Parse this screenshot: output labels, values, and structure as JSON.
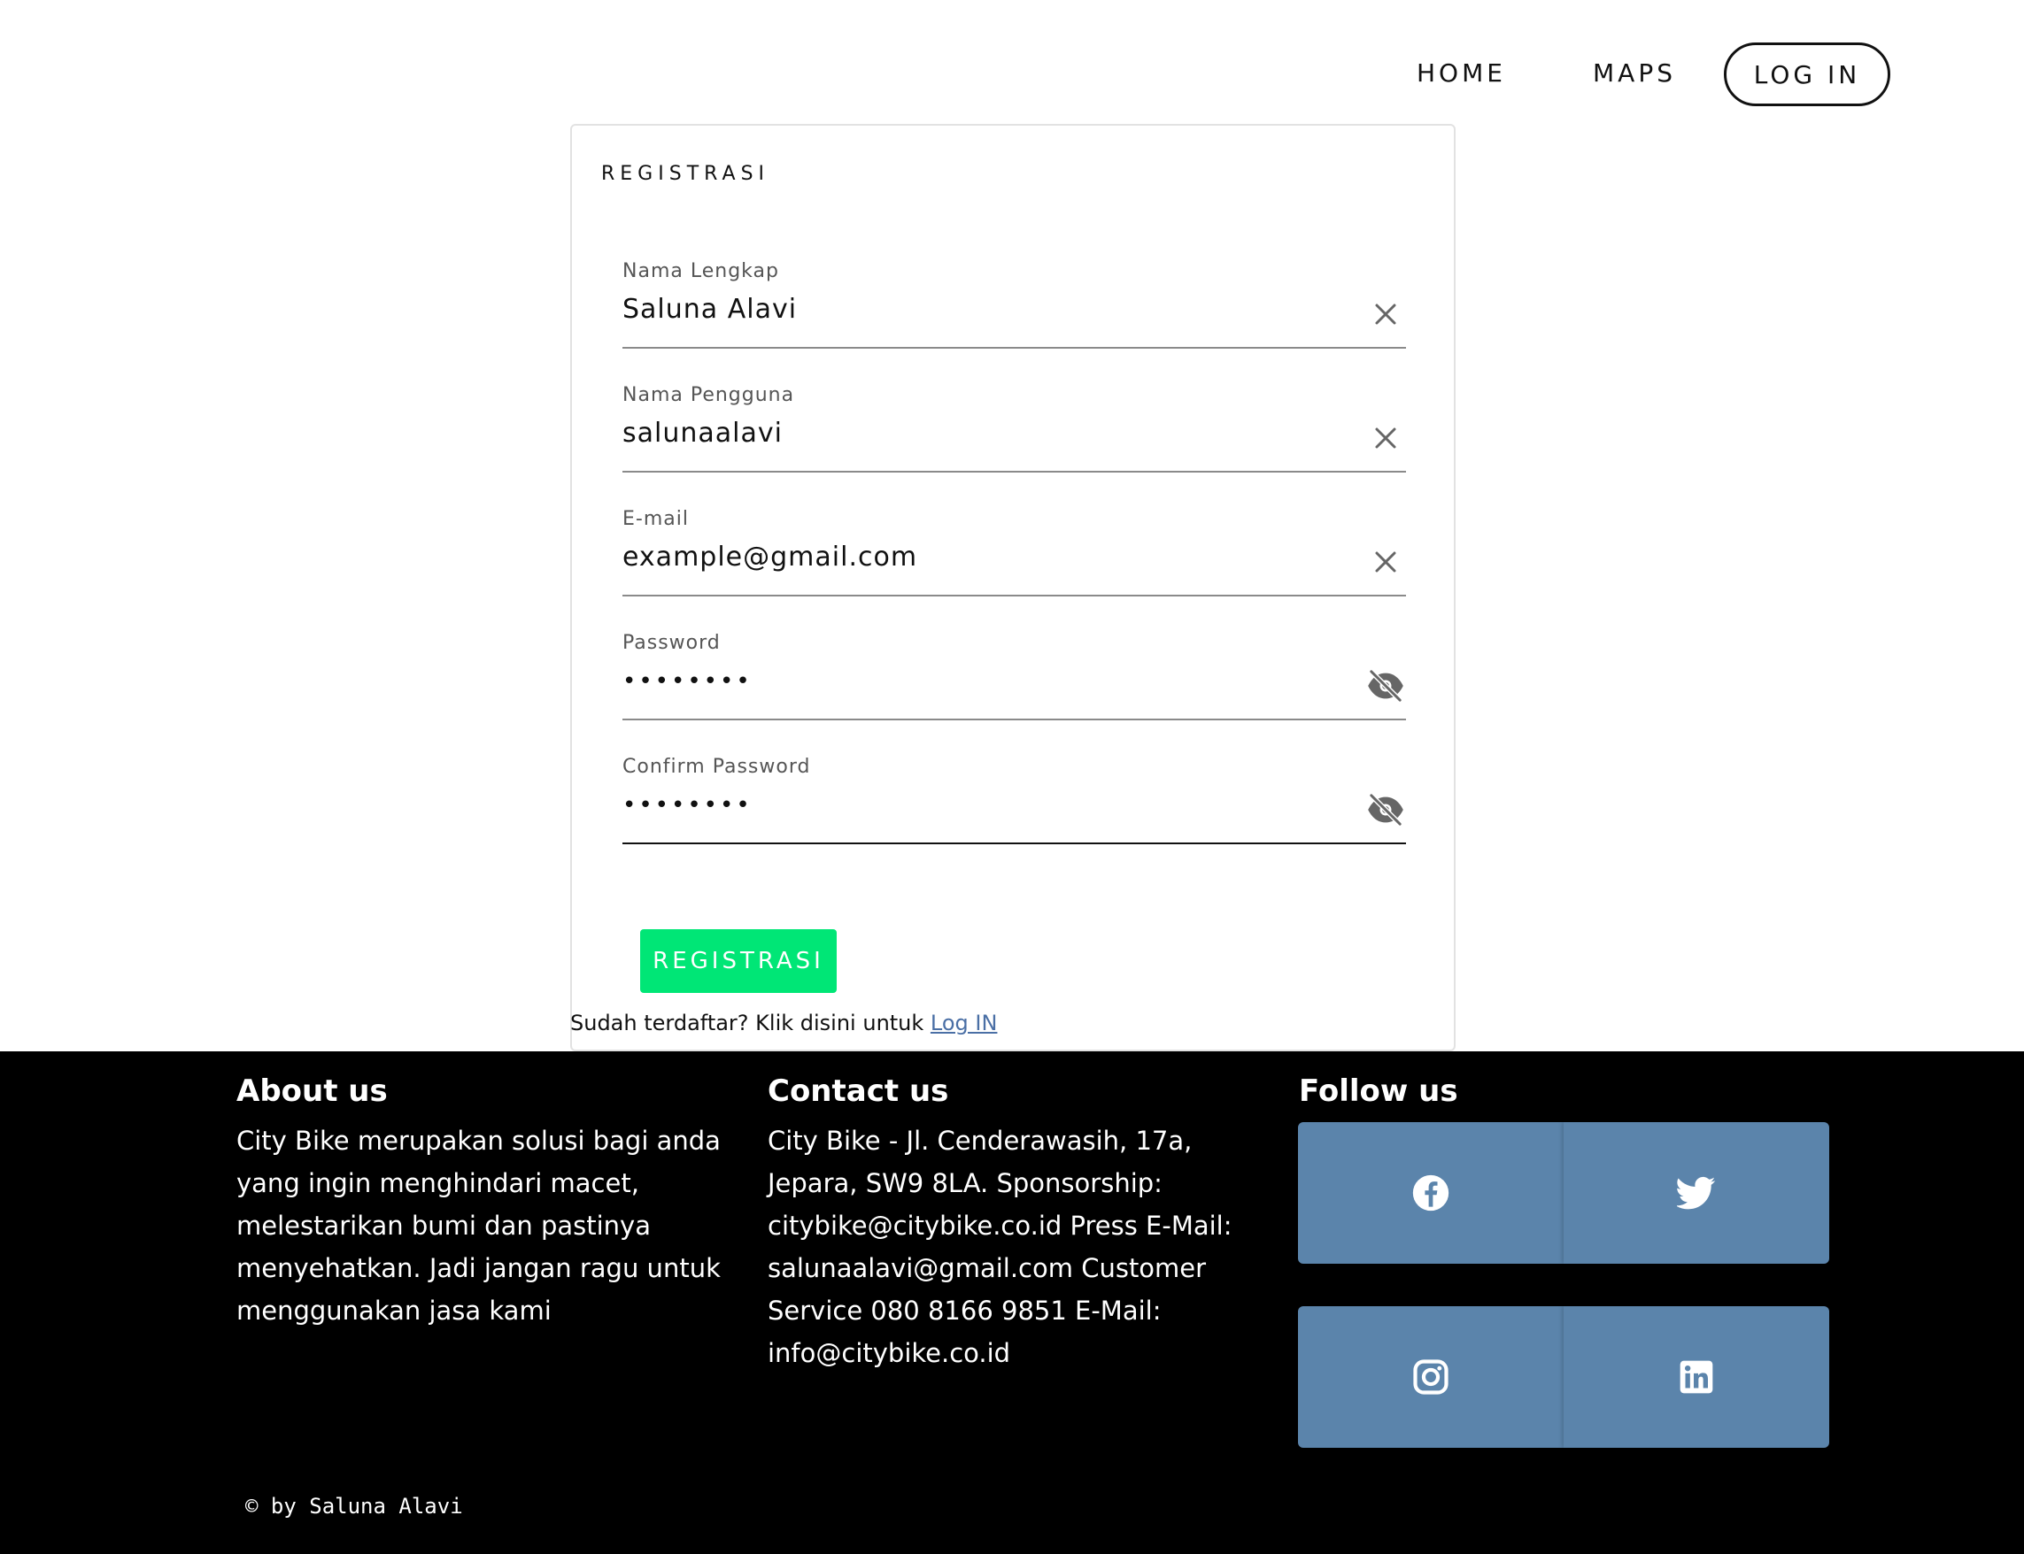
{
  "nav": {
    "home": "HOME",
    "maps": "MAPS",
    "login": "LOG IN"
  },
  "form": {
    "title": "REGISTRASI",
    "fields": [
      {
        "label": "Nama Lengkap",
        "value": "Saluna Alavi",
        "icon": "clear-icon"
      },
      {
        "label": "Nama Pengguna",
        "value": "salunaalavi",
        "icon": "clear-icon"
      },
      {
        "label": "E-mail",
        "value": "example@gmail.com",
        "icon": "clear-icon"
      },
      {
        "label": "Password",
        "value": "••••••••",
        "icon": "eye-off-icon"
      },
      {
        "label": "Confirm Password",
        "value": "••••••••",
        "icon": "eye-off-icon"
      }
    ],
    "submit": "REGISTRASI",
    "already_text": "Sudah terdaftar? Klik disini untuk ",
    "login_link": "Log IN"
  },
  "footer": {
    "about": {
      "title": "About us",
      "text": "City Bike merupakan solusi bagi anda yang ingin menghindari macet, melestarikan bumi dan pastinya menyehatkan. Jadi jangan ragu untuk menggunakan jasa kami"
    },
    "contact": {
      "title": "Contact us",
      "text": "City Bike - Jl. Cenderawasih, 17a, Jepara, SW9 8LA. Sponsorship: citybike@citybike.co.id Press E-Mail: salunaalavi@gmail.com Customer Service 080 8166 9851 E-Mail: info@citybike.co.id"
    },
    "follow": {
      "title": "Follow us",
      "icons": [
        "facebook-icon",
        "twitter-icon",
        "instagram-icon",
        "linkedin-icon"
      ]
    },
    "copyright": "© by Saluna Alavi"
  },
  "colors": {
    "accent": "#00e676",
    "social_bg": "#5b84ab",
    "footer_bg": "#000000",
    "link": "#4a6fa5"
  }
}
